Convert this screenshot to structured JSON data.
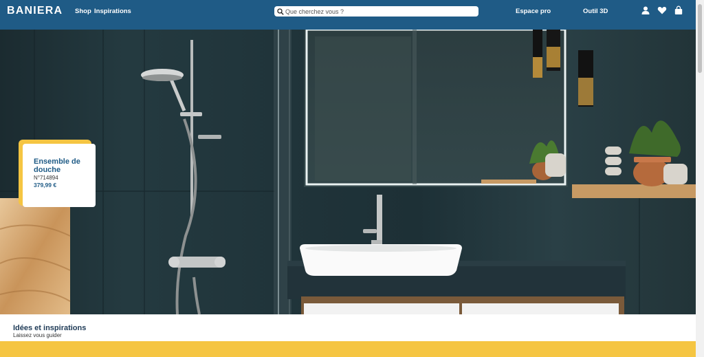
{
  "header": {
    "logo": "BANIERA",
    "nav": [
      "Shop",
      "Inspirations"
    ],
    "search_placeholder": "Que cherchez vous ?",
    "pro_link": "Espace pro",
    "tool_link": "Outil 3D",
    "icons": [
      "user-icon",
      "heart-icon",
      "shopping-bag-icon",
      "search-icon"
    ]
  },
  "product": {
    "title": "Ensemble de douche",
    "reference": "N°714894",
    "price": "379,99 €"
  },
  "section": {
    "title": "Idées et inspirations",
    "subtitle": "Laissez vous guider"
  },
  "colors": {
    "brand_blue": "#1f5b86",
    "accent_yellow": "#f5c542"
  }
}
